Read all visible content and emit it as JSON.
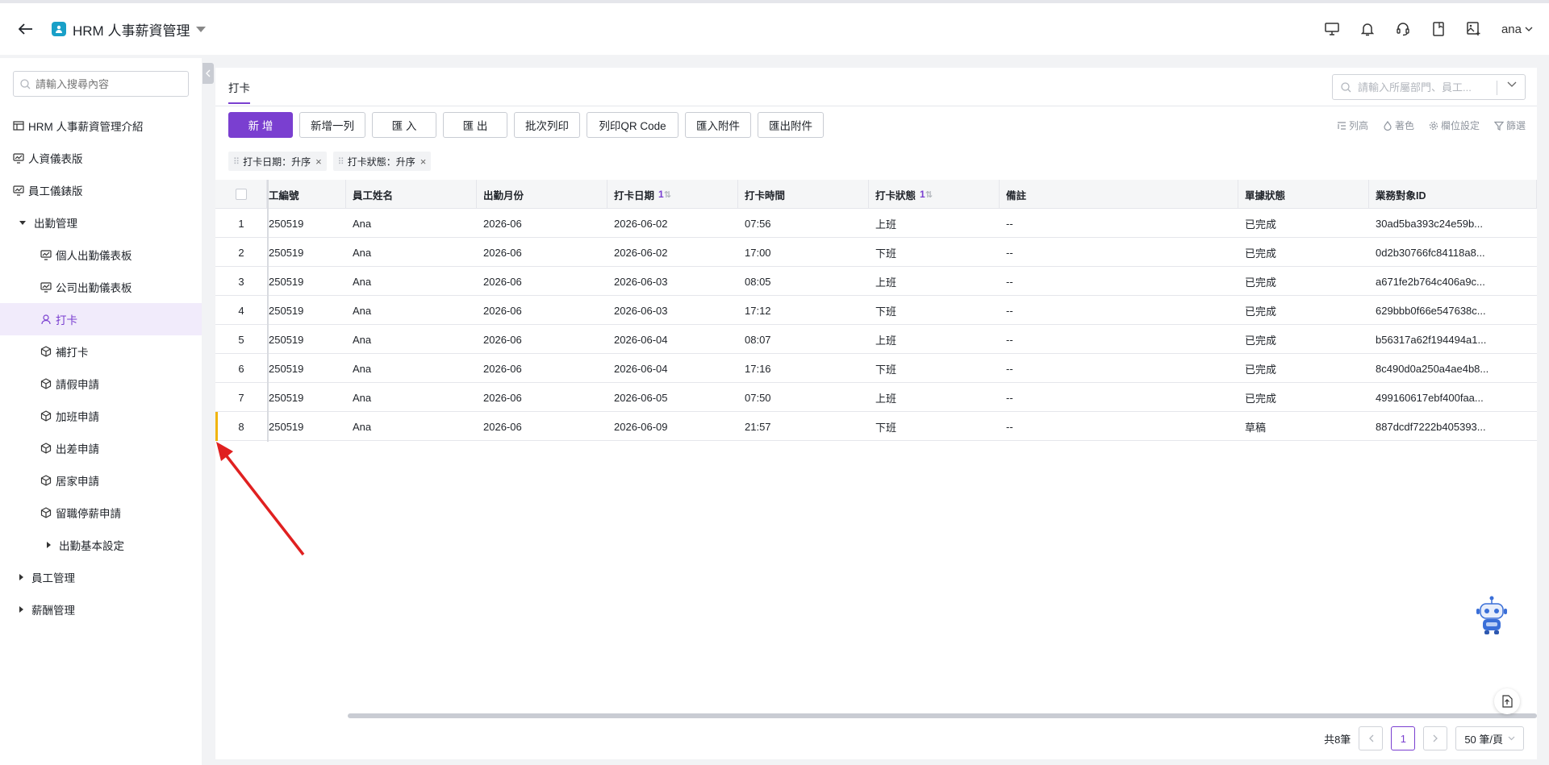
{
  "app": {
    "title": "HRM 人事薪資管理",
    "user": "ana"
  },
  "sidebar": {
    "search_placeholder": "請輸入搜尋內容",
    "items": [
      {
        "label": "HRM 人事薪資管理介紹"
      },
      {
        "label": "人資儀表版"
      },
      {
        "label": "員工儀錶版"
      },
      {
        "label": "出勤管理"
      },
      {
        "label": "個人出勤儀表板"
      },
      {
        "label": "公司出勤儀表板"
      },
      {
        "label": "打卡"
      },
      {
        "label": "補打卡"
      },
      {
        "label": "請假申請"
      },
      {
        "label": "加班申請"
      },
      {
        "label": "出差申請"
      },
      {
        "label": "居家申請"
      },
      {
        "label": "留職停薪申請"
      },
      {
        "label": "出勤基本設定"
      },
      {
        "label": "員工管理"
      },
      {
        "label": "薪酬管理"
      }
    ]
  },
  "tab": {
    "label": "打卡"
  },
  "panel_search": {
    "placeholder": "請輸入所屬部門、員工..."
  },
  "toolbar": {
    "new": "新 增",
    "add_row": "新增一列",
    "import": "匯 入",
    "export": "匯 出",
    "batch_print": "批次列印",
    "print_qr": "列印QR Code",
    "import_attach": "匯入附件",
    "export_attach": "匯出附件",
    "row_height": "列高",
    "color": "著色",
    "field_settings": "欄位設定",
    "filter": "篩選"
  },
  "sort_chips": [
    {
      "label": "打卡日期：升序"
    },
    {
      "label": "打卡狀態：升序"
    }
  ],
  "table": {
    "headers": {
      "emp_no": "工編號",
      "name": "員工姓名",
      "month": "出勤月份",
      "date": "打卡日期",
      "time": "打卡時間",
      "status": "打卡狀態",
      "note": "備註",
      "doc_status": "單據狀態",
      "biz_id": "業務對象ID",
      "sort_num": "1"
    },
    "rows": [
      {
        "idx": "1",
        "emp_no": "250519",
        "name": "Ana",
        "month": "2026-06",
        "date": "2026-06-02",
        "time": "07:56",
        "status": "上班",
        "note": "--",
        "doc_status": "已完成",
        "biz_id": "30ad5ba393c24e59b..."
      },
      {
        "idx": "2",
        "emp_no": "250519",
        "name": "Ana",
        "month": "2026-06",
        "date": "2026-06-02",
        "time": "17:00",
        "status": "下班",
        "note": "--",
        "doc_status": "已完成",
        "biz_id": "0d2b30766fc84118a8..."
      },
      {
        "idx": "3",
        "emp_no": "250519",
        "name": "Ana",
        "month": "2026-06",
        "date": "2026-06-03",
        "time": "08:05",
        "status": "上班",
        "note": "--",
        "doc_status": "已完成",
        "biz_id": "a671fe2b764c406a9c..."
      },
      {
        "idx": "4",
        "emp_no": "250519",
        "name": "Ana",
        "month": "2026-06",
        "date": "2026-06-03",
        "time": "17:12",
        "status": "下班",
        "note": "--",
        "doc_status": "已完成",
        "biz_id": "629bbb0f66e547638c..."
      },
      {
        "idx": "5",
        "emp_no": "250519",
        "name": "Ana",
        "month": "2026-06",
        "date": "2026-06-04",
        "time": "08:07",
        "status": "上班",
        "note": "--",
        "doc_status": "已完成",
        "biz_id": "b56317a62f194494a1..."
      },
      {
        "idx": "6",
        "emp_no": "250519",
        "name": "Ana",
        "month": "2026-06",
        "date": "2026-06-04",
        "time": "17:16",
        "status": "下班",
        "note": "--",
        "doc_status": "已完成",
        "biz_id": "8c490d0a250a4ae4b8..."
      },
      {
        "idx": "7",
        "emp_no": "250519",
        "name": "Ana",
        "month": "2026-06",
        "date": "2026-06-05",
        "time": "07:50",
        "status": "上班",
        "note": "--",
        "doc_status": "已完成",
        "biz_id": "499160617ebf400faa..."
      },
      {
        "idx": "8",
        "emp_no": "250519",
        "name": "Ana",
        "month": "2026-06",
        "date": "2026-06-09",
        "time": "21:57",
        "status": "下班",
        "note": "--",
        "doc_status": "草稿",
        "biz_id": "887dcdf7222b405393..."
      }
    ]
  },
  "pager": {
    "total": "共8筆",
    "current": "1",
    "page_size": "50 筆/頁"
  },
  "colors": {
    "accent": "#7a3fd0",
    "row_marker": "#f0b40c",
    "annotation_arrow": "#e02020"
  }
}
